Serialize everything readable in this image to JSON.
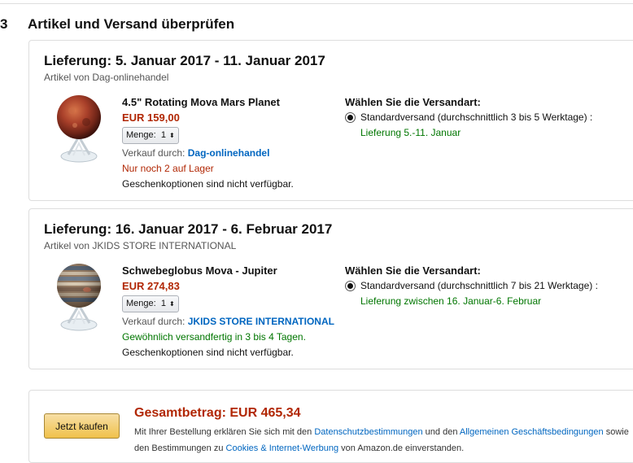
{
  "step": {
    "number": "3",
    "title": "Artikel und Versand überprüfen"
  },
  "shipments": [
    {
      "delivery": "Lieferung: 5. Januar 2017 - 11. Januar 2017",
      "seller_line": "Artikel von Dag-onlinehandel",
      "product_name": "4.5\" Rotating Mova Mars Planet",
      "price": "EUR 159,00",
      "qty_label": "Menge:",
      "qty_value": "1",
      "sold_by_label": "Verkauf durch:",
      "sold_by": "Dag-onlinehandel",
      "stock": "Nur noch 2 auf Lager",
      "gift": "Geschenkoptionen sind nicht verfügbar.",
      "ship_heading": "Wählen Sie die Versandart:",
      "ship_option": "Standardversand (durchschnittlich 3 bis 5 Werktage) :",
      "ship_date": "Lieferung 5.-11. Januar"
    },
    {
      "delivery": "Lieferung: 16. Januar 2017 - 6. Februar 2017",
      "seller_line": "Artikel von JKIDS STORE INTERNATIONAL",
      "product_name": "Schwebeglobus Mova - Jupiter",
      "price": "EUR 274,83",
      "qty_label": "Menge:",
      "qty_value": "1",
      "sold_by_label": "Verkauf durch:",
      "sold_by": "JKIDS STORE INTERNATIONAL",
      "stock": "Gewöhnlich versandfertig in 3 bis 4 Tagen.",
      "gift": "Geschenkoptionen sind nicht verfügbar.",
      "ship_heading": "Wählen Sie die Versandart:",
      "ship_option": "Standardversand (durchschnittlich 7 bis 21 Werktage) :",
      "ship_date": "Lieferung zwischen 16. Januar-6. Februar"
    }
  ],
  "order": {
    "buy_button": "Jetzt kaufen",
    "total": "Gesamtbetrag: EUR 465,34",
    "legal_1": "Mit Ihrer Bestellung erklären Sie sich mit den ",
    "legal_link_1": "Datenschutzbestimmungen",
    "legal_2": " und den ",
    "legal_link_2": "Allgemeinen Geschäftsbedingungen",
    "legal_3": " sowie den Bestimmungen zu ",
    "legal_link_3": "Cookies & Internet-Werbung",
    "legal_4": " von Amazon.de einverstanden."
  }
}
